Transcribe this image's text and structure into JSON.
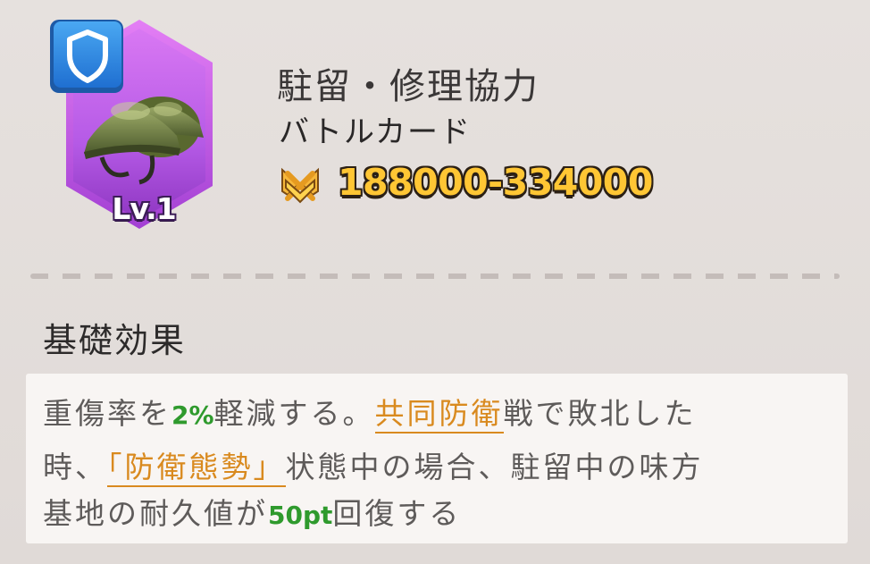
{
  "card": {
    "level_label": "Lv.1",
    "image": "helmet-icon",
    "type_badge": "shield-icon",
    "frame_color": "#b452e0"
  },
  "header": {
    "title": "駐留・修理協力",
    "subtitle": "バトルカード",
    "power_icon": "crossed-swords-icon",
    "power_range": "188000-334000"
  },
  "section": {
    "title": "基礎効果"
  },
  "effect": {
    "line1_a": "重傷率を",
    "line1_num": "2%",
    "line1_b": "軽減する。",
    "line1_link": "共同防衛",
    "line1_c": "戦で敗北した",
    "line2_a": "時、",
    "line2_link": "「防衛態勢」",
    "line2_b": "状態中の場合、駐留中の味方",
    "line3_a": "基地の耐久値が",
    "line3_num": "50pt",
    "line3_b": "回復する"
  },
  "colors": {
    "highlight_number": "#2f9a2d",
    "link_text": "#d98a1f",
    "power_text": "#ffc634"
  }
}
